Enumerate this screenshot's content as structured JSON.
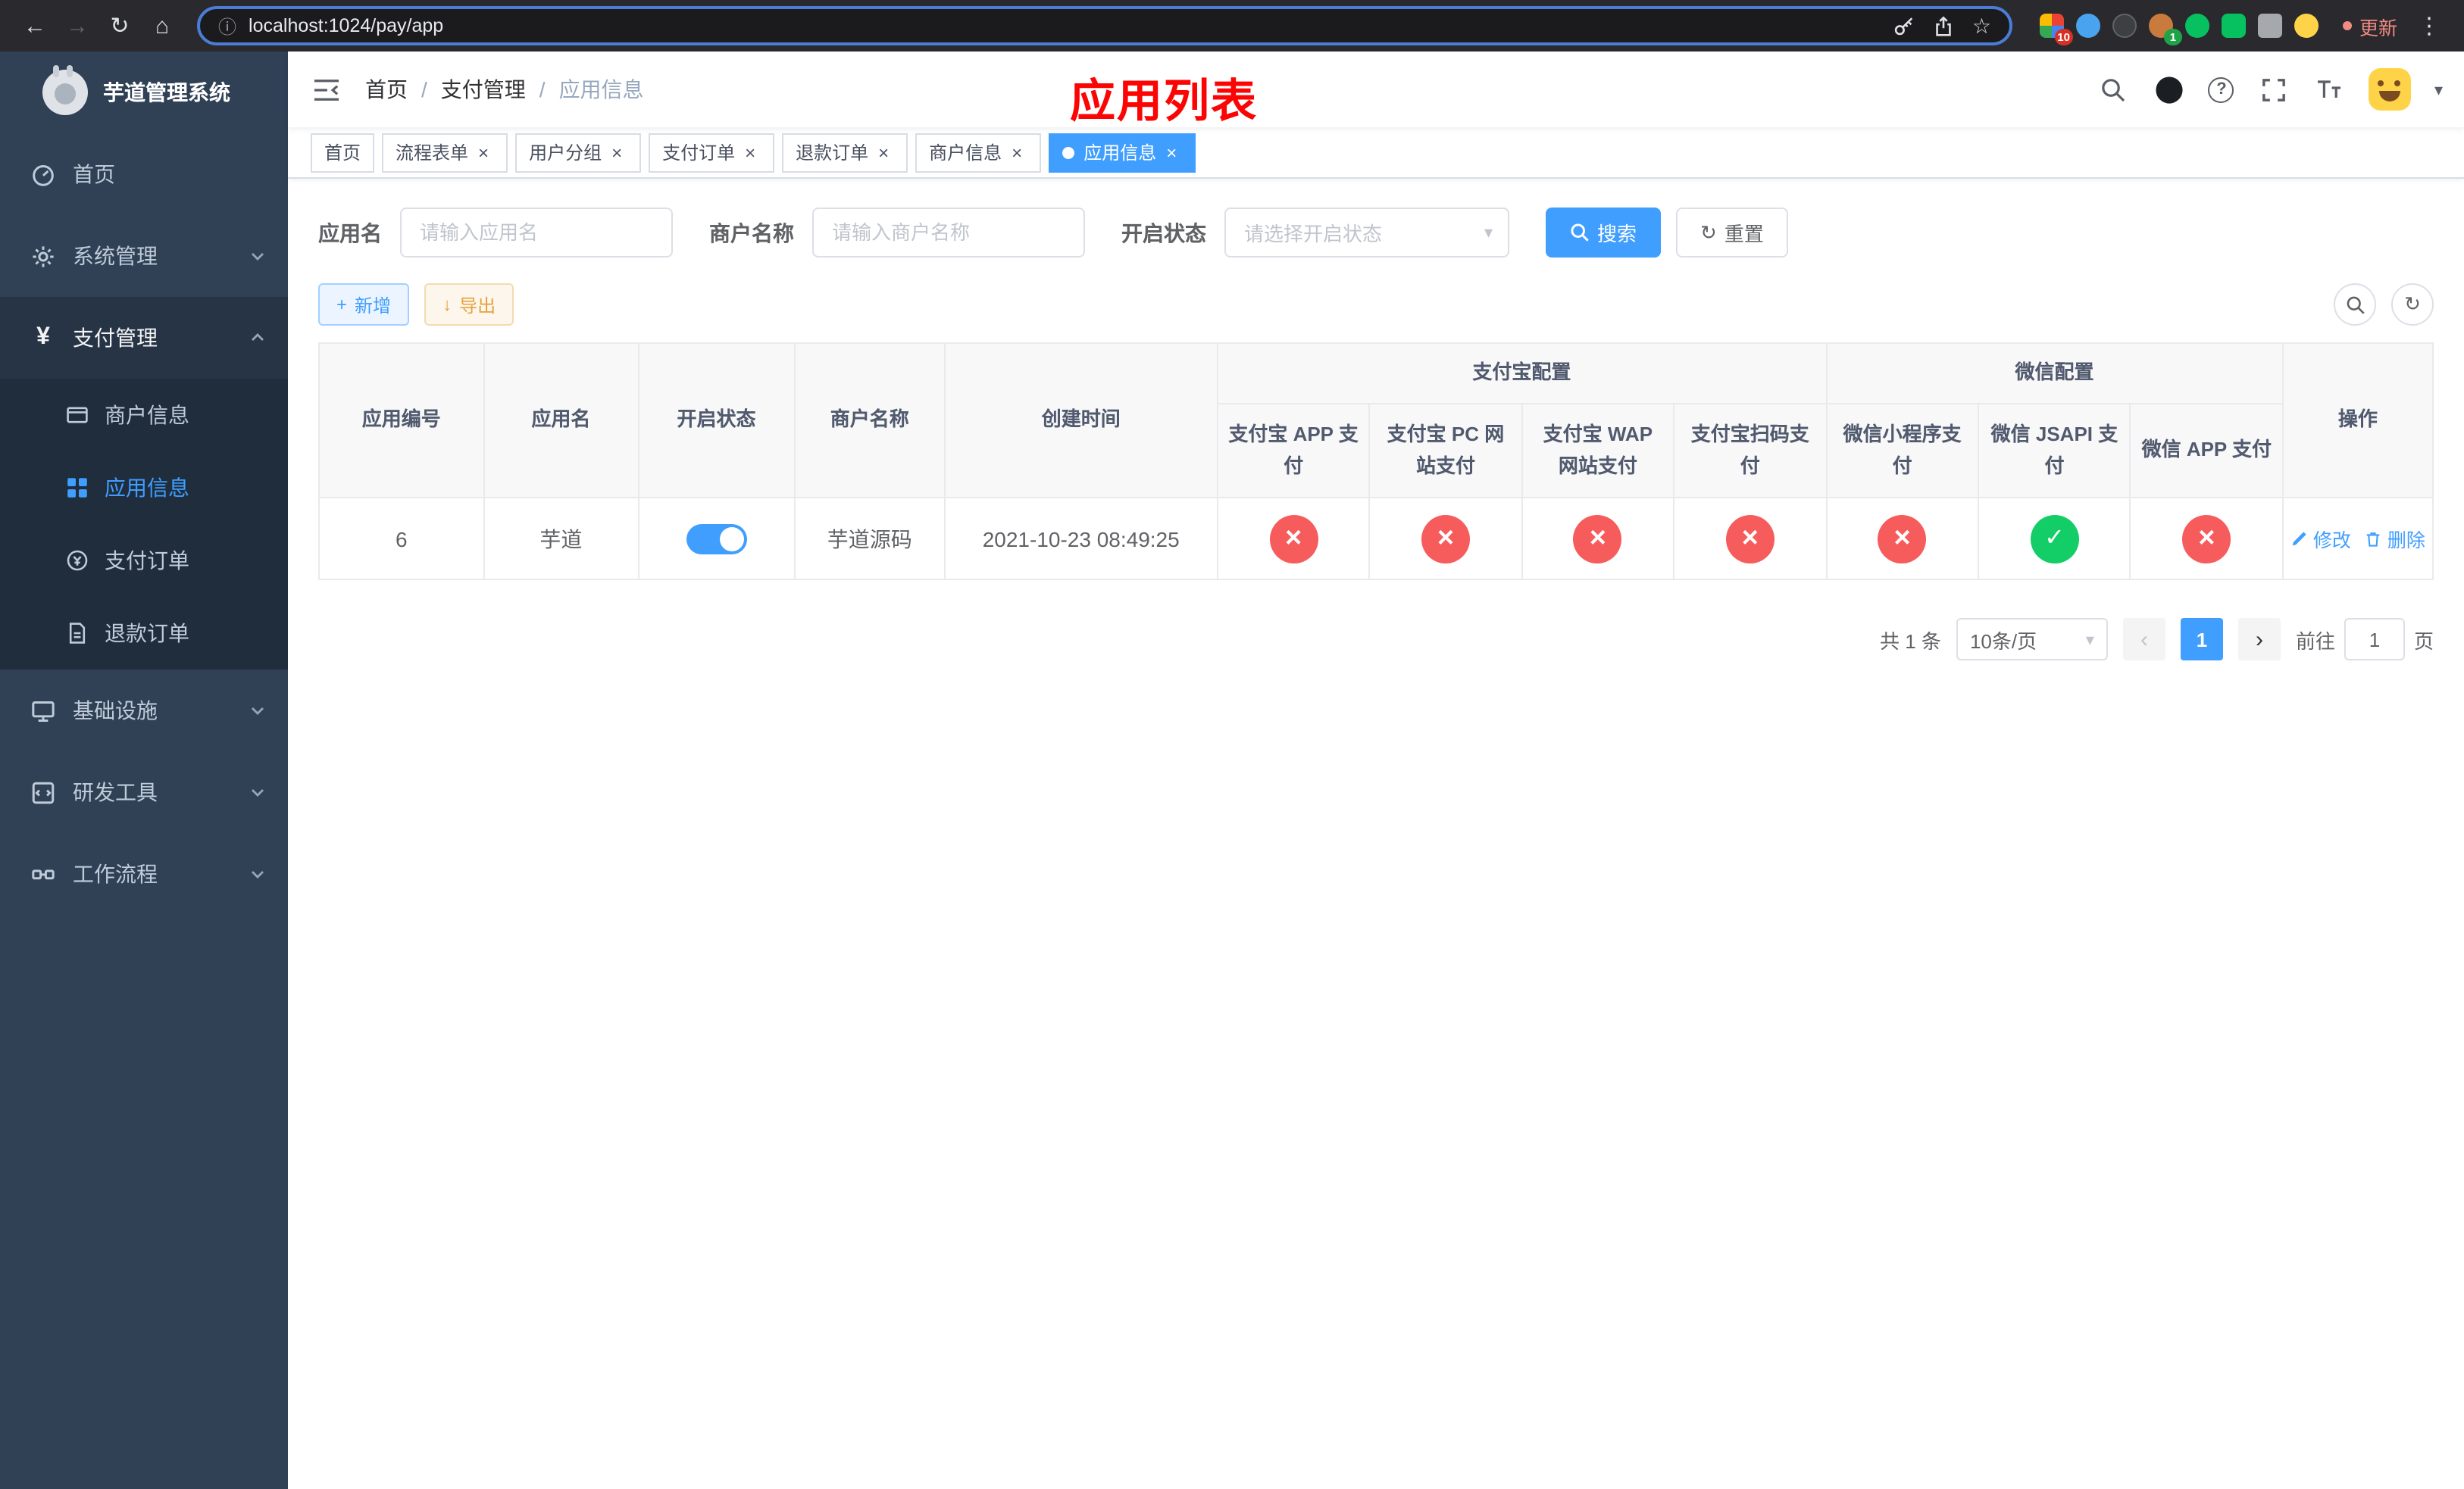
{
  "browser": {
    "url": "localhost:1024/pay/app",
    "update_label": "更新",
    "extension_badges": {
      "grid": "10",
      "avatar": "1"
    }
  },
  "annotation": "应用列表",
  "sidebar": {
    "logo_title": "芋道管理系统",
    "items": [
      {
        "label": "首页",
        "active": false
      },
      {
        "label": "系统管理",
        "expanded": false
      },
      {
        "label": "支付管理",
        "expanded": true
      },
      {
        "label": "商户信息",
        "active": false
      },
      {
        "label": "应用信息",
        "active": true
      },
      {
        "label": "支付订单",
        "active": false
      },
      {
        "label": "退款订单",
        "active": false
      },
      {
        "label": "基础设施",
        "expanded": false
      },
      {
        "label": "研发工具",
        "expanded": false
      },
      {
        "label": "工作流程",
        "expanded": false
      }
    ]
  },
  "breadcrumb": {
    "separator": "/",
    "items": [
      "首页",
      "支付管理",
      "应用信息"
    ]
  },
  "tabs": [
    {
      "label": "首页",
      "closable": false,
      "active": false
    },
    {
      "label": "流程表单",
      "closable": true,
      "active": false
    },
    {
      "label": "用户分组",
      "closable": true,
      "active": false
    },
    {
      "label": "支付订单",
      "closable": true,
      "active": false
    },
    {
      "label": "退款订单",
      "closable": true,
      "active": false
    },
    {
      "label": "商户信息",
      "closable": true,
      "active": false
    },
    {
      "label": "应用信息",
      "closable": true,
      "active": true
    }
  ],
  "filters": {
    "app_name": {
      "label": "应用名",
      "placeholder": "请输入应用名",
      "value": ""
    },
    "merchant_name": {
      "label": "商户名称",
      "placeholder": "请输入商户名称",
      "value": ""
    },
    "status": {
      "label": "开启状态",
      "placeholder": "请选择开启状态"
    },
    "search_button": "搜索",
    "reset_button": "重置"
  },
  "toolbar": {
    "add_button": "新增",
    "export_button": "导出"
  },
  "table": {
    "columns": {
      "app_id": "应用编号",
      "app_name": "应用名",
      "status": "开启状态",
      "merchant": "商户名称",
      "created": "创建时间",
      "alipay_group": "支付宝配置",
      "wechat_group": "微信配置",
      "actions": "操作",
      "alipay_app": "支付宝 APP 支付",
      "alipay_pc": "支付宝 PC 网站支付",
      "alipay_wap": "支付宝 WAP 网站支付",
      "alipay_qr": "支付宝扫码支付",
      "wx_mini": "微信小程序支付",
      "wx_jsapi": "微信 JSAPI 支付",
      "wx_app": "微信 APP 支付"
    },
    "actions": {
      "edit": "修改",
      "delete": "删除"
    },
    "rows": [
      {
        "app_id": "6",
        "app_name": "芋道",
        "status_on": true,
        "merchant": "芋道源码",
        "created": "2021-10-23 08:49:25",
        "alipay_app": "disabled",
        "alipay_pc": "disabled",
        "alipay_wap": "disabled",
        "alipay_qr": "disabled",
        "wx_mini": "disabled",
        "wx_jsapi": "enabled",
        "wx_app": "disabled"
      }
    ]
  },
  "pagination": {
    "total_text": "共 1 条",
    "page_size_text": "10条/页",
    "current_page": "1",
    "goto_label": "前往",
    "goto_value": "1",
    "goto_unit": "页"
  },
  "icons": {
    "back_arrow": "←",
    "forward_arrow": "→",
    "reload": "↻",
    "home": "⌂",
    "info": "ⓘ",
    "star": "☆",
    "menu_dots": "⋮",
    "close": "×",
    "caret": "▾",
    "prev": "‹",
    "next": "›",
    "yen": "¥",
    "question": "?",
    "plus": "+",
    "download": "↓",
    "refresh": "↻"
  },
  "colors": {
    "primary": "#409eff",
    "success": "#13ce66",
    "danger": "#f75c5c",
    "warning": "#e6a23c",
    "sidebar_bg": "#304156",
    "submenu_bg": "#1f2d3d",
    "annotation_red": "#fd0404"
  }
}
